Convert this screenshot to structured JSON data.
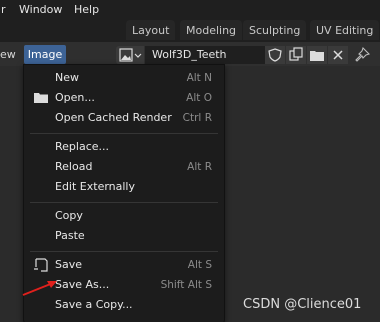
{
  "top_menu": {
    "items": [
      "r",
      "Window",
      "Help"
    ],
    "workspaces": [
      "Layout",
      "Modeling",
      "Sculpting",
      "UV Editing"
    ]
  },
  "header": {
    "view_label": "ew",
    "image_menu_label": "Image",
    "image_name": "Wolf3D_Teeth"
  },
  "image_menu": {
    "groups": [
      [
        {
          "label": "New",
          "shortcut": "Alt N",
          "icon": ""
        },
        {
          "label": "Open...",
          "shortcut": "Alt O",
          "icon": "folder-icon"
        },
        {
          "label": "Open Cached Render",
          "shortcut": "Ctrl R",
          "icon": ""
        }
      ],
      [
        {
          "label": "Replace...",
          "shortcut": "",
          "icon": ""
        },
        {
          "label": "Reload",
          "shortcut": "Alt R",
          "icon": ""
        },
        {
          "label": "Edit Externally",
          "shortcut": "",
          "icon": ""
        }
      ],
      [
        {
          "label": "Copy",
          "shortcut": "",
          "icon": ""
        },
        {
          "label": "Paste",
          "shortcut": "",
          "icon": ""
        }
      ],
      [
        {
          "label": "Save",
          "shortcut": "Alt S",
          "icon": "save-icon"
        },
        {
          "label": "Save As...",
          "shortcut": "Shift Alt S",
          "icon": ""
        },
        {
          "label": "Save a Copy...",
          "shortcut": "",
          "icon": ""
        }
      ]
    ]
  },
  "watermark": "CSDN @Clience01",
  "colors": {
    "accent": "#3d6396",
    "menu_bg": "#1c1c1c",
    "shortcut_text": "#8c8c8c",
    "annotation_arrow": "#e0201c"
  }
}
